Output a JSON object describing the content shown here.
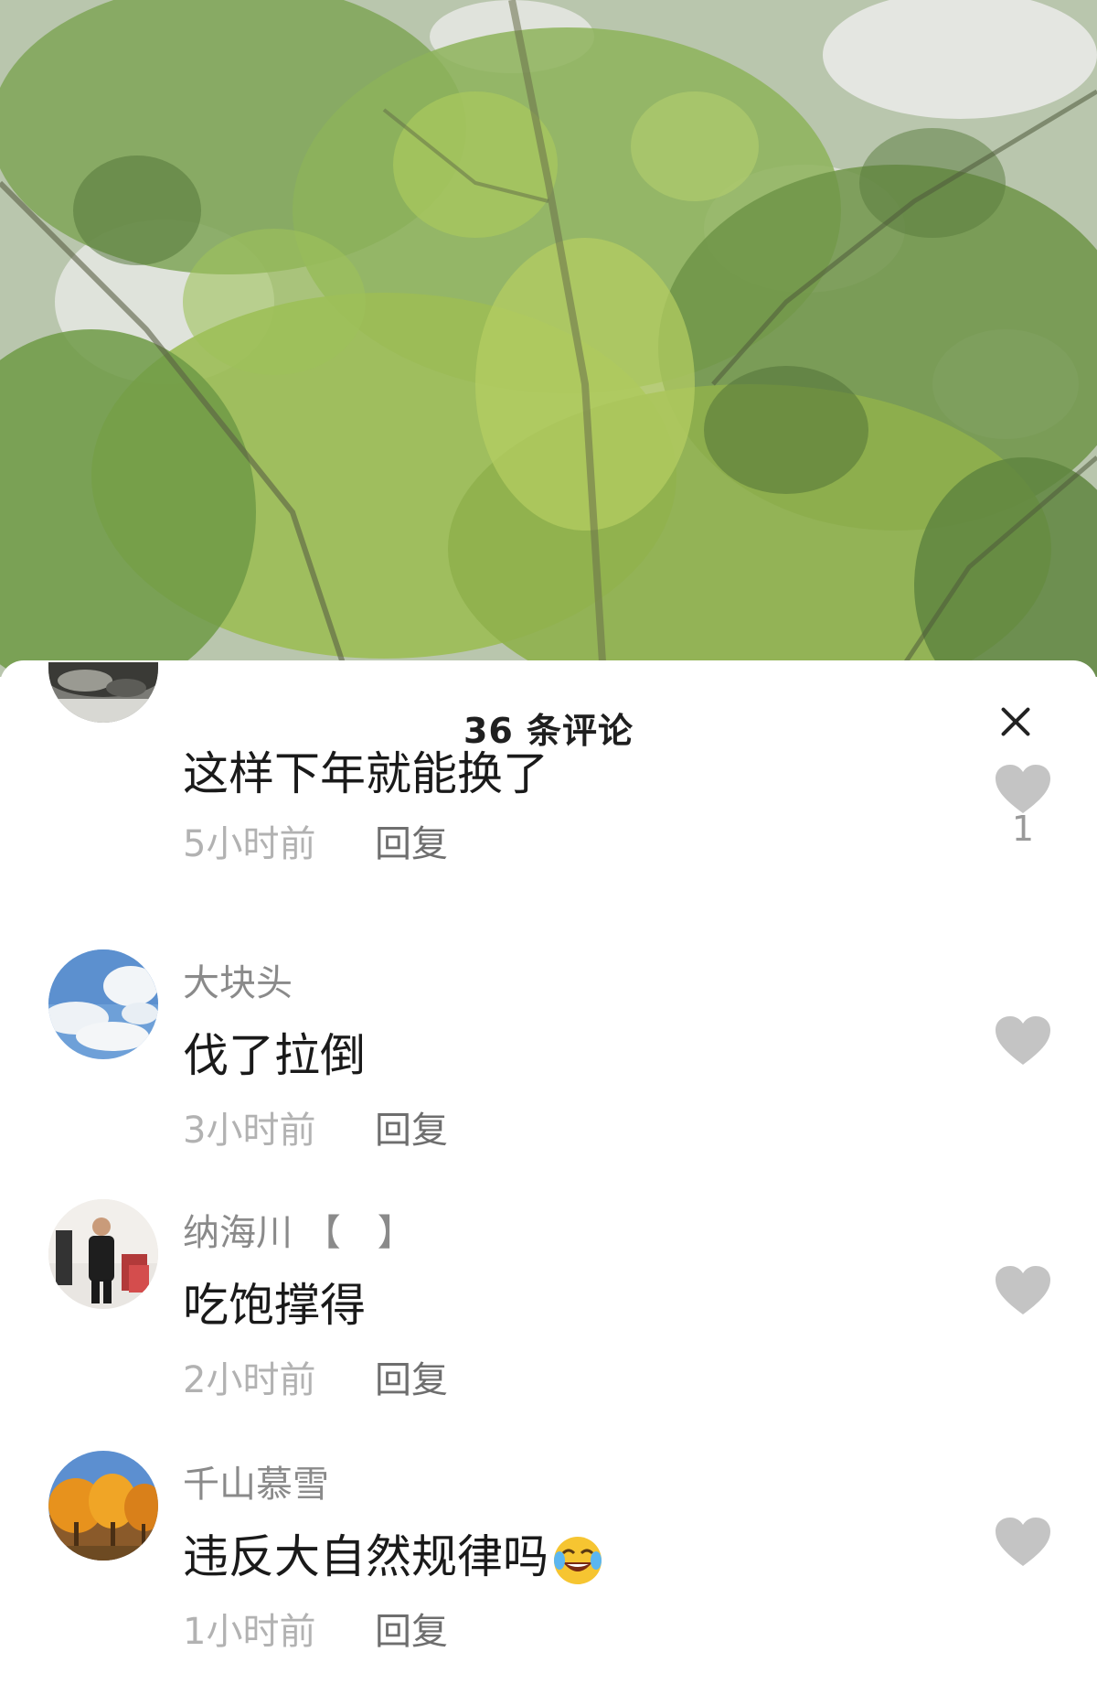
{
  "sheet": {
    "title": "36 条评论",
    "close_icon": "close-icon"
  },
  "comments": [
    {
      "username": "",
      "text": "这样下年就能换了",
      "time": "5小时前",
      "reply_label": "回复",
      "like_count": "1"
    },
    {
      "username": "大块头",
      "text": "伐了拉倒",
      "time": "3小时前",
      "reply_label": "回复",
      "like_count": ""
    },
    {
      "username": "纳海川 【　】",
      "text": "吃饱撑得",
      "time": "2小时前",
      "reply_label": "回复",
      "like_count": ""
    },
    {
      "username": "千山慕雪",
      "text": "违反大自然规律吗",
      "time": "1小时前",
      "reply_label": "回复",
      "like_count": "",
      "emoji_icon": "laughing-face-icon"
    }
  ],
  "colors": {
    "like_icon": "#c4c4c4",
    "title_text": "#1f1f1f",
    "meta_text": "#b2b2b2"
  }
}
